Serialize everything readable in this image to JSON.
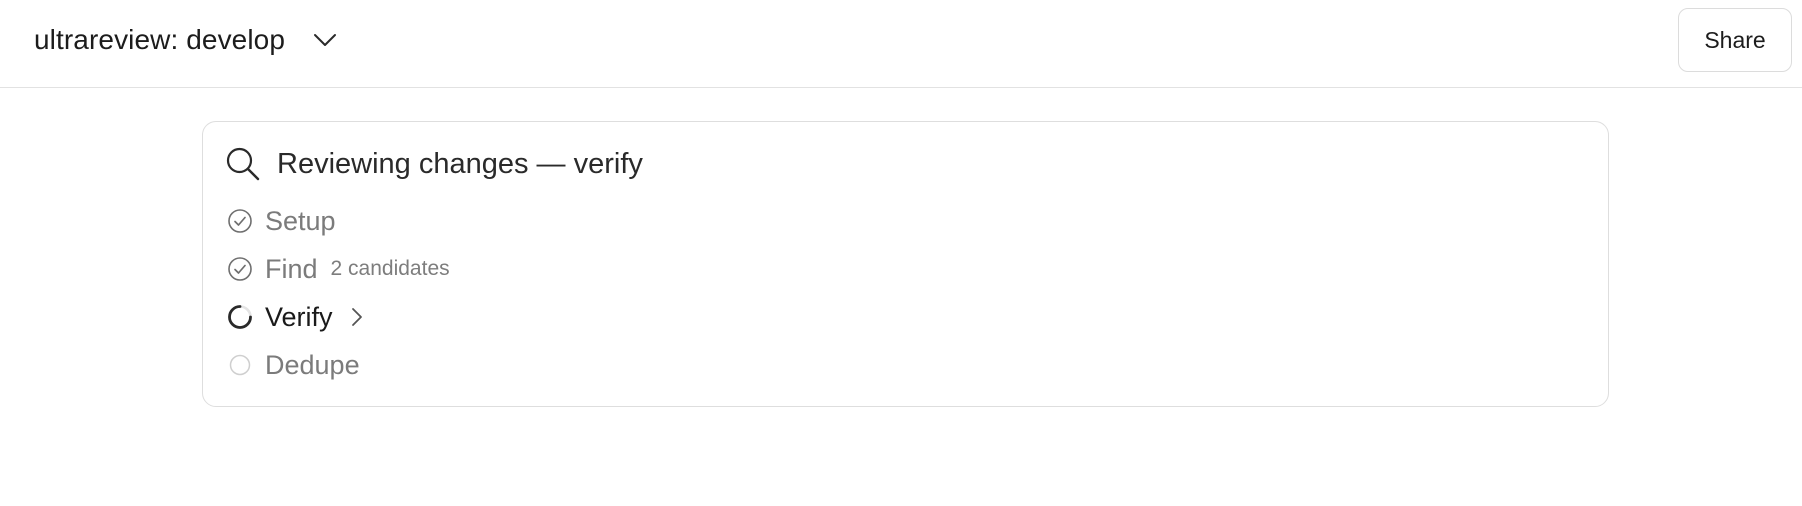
{
  "header": {
    "title": "ultrareview: develop",
    "title_menu_icon": "chevron-down-icon",
    "share_label": "Share"
  },
  "review": {
    "icon": "search-icon",
    "title": "Reviewing changes — verify",
    "steps": [
      {
        "label": "Setup",
        "status": "done",
        "icon": "check-circle-icon",
        "meta": ""
      },
      {
        "label": "Find",
        "status": "done",
        "icon": "check-circle-icon",
        "meta": "2 candidates"
      },
      {
        "label": "Verify",
        "status": "in-progress",
        "icon": "spinner-icon",
        "meta": "",
        "expand_icon": "chevron-right-icon"
      },
      {
        "label": "Dedupe",
        "status": "pending",
        "icon": "empty-circle-icon",
        "meta": ""
      }
    ]
  },
  "colors": {
    "text_primary": "#1c1c1c",
    "text_muted": "#7b7b7b",
    "border": "#dedede",
    "background": "#ffffff"
  }
}
